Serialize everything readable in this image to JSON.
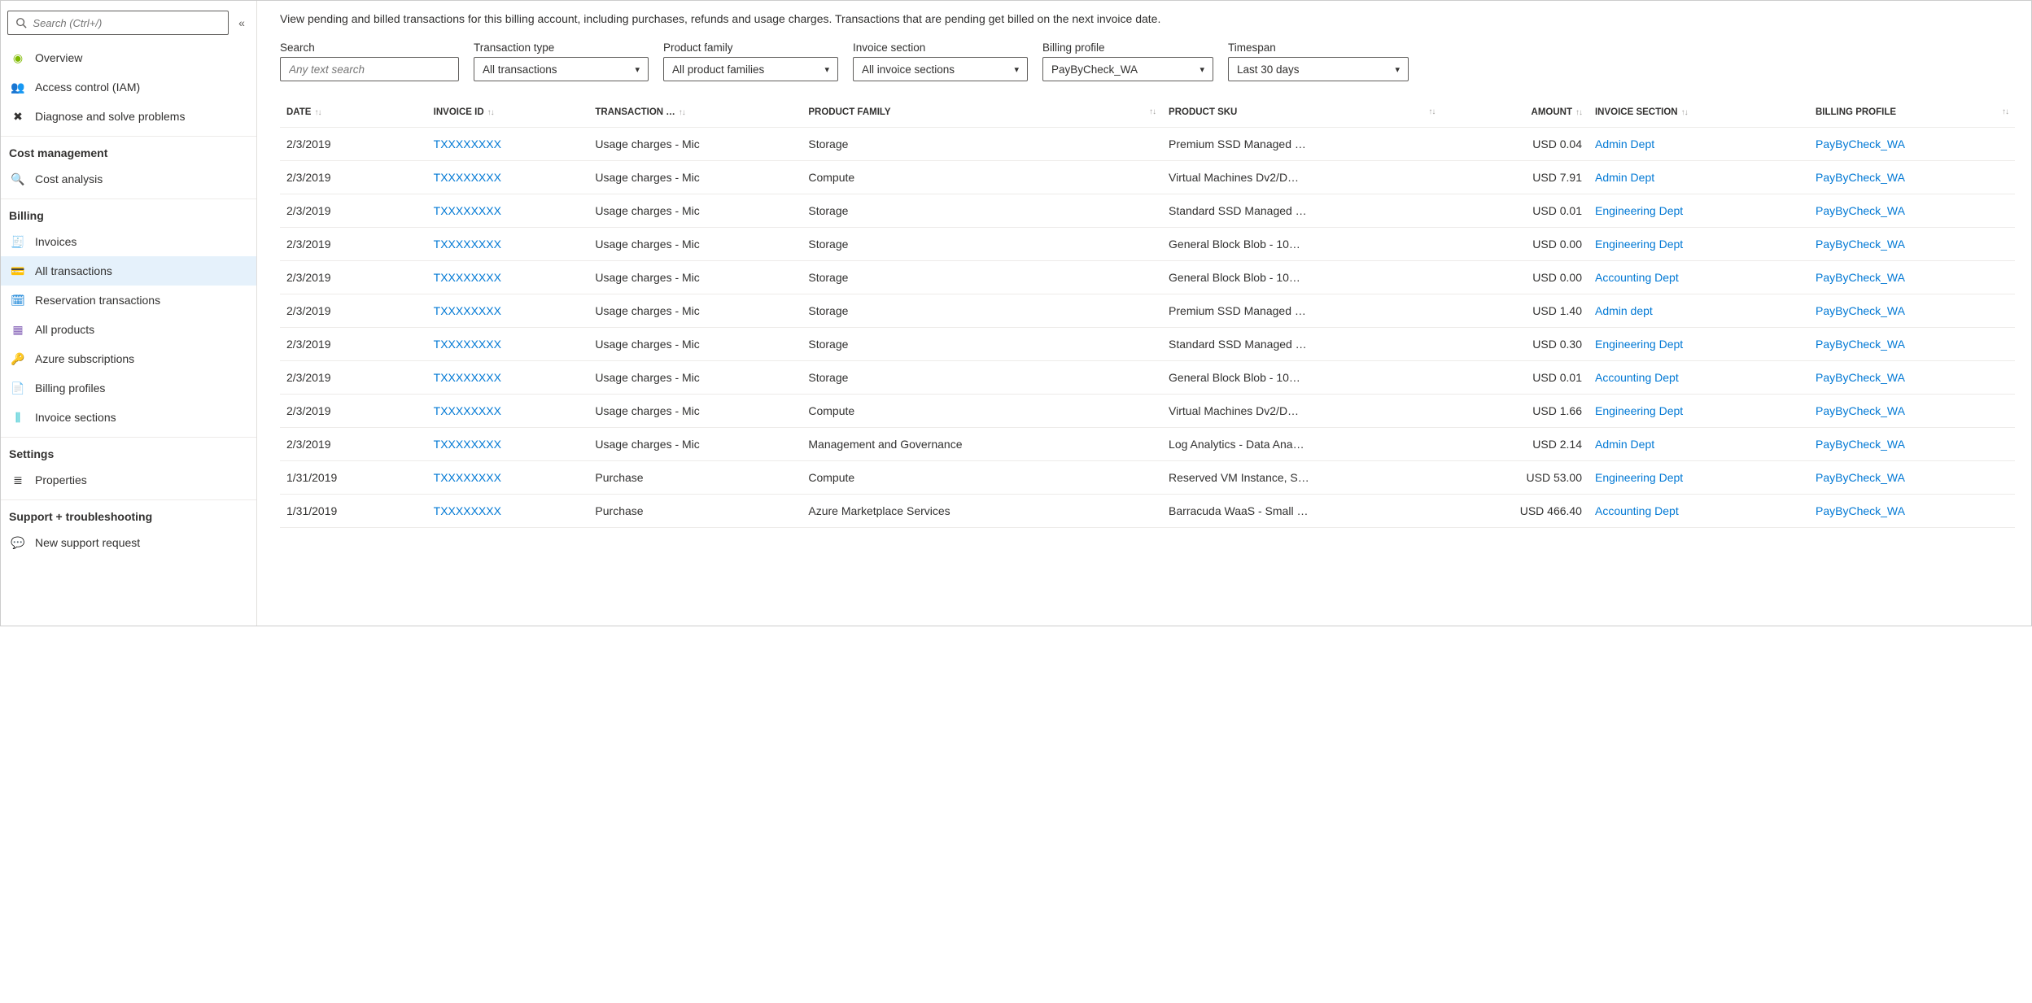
{
  "sidebar": {
    "search_placeholder": "Search (Ctrl+/)",
    "top_items": [
      {
        "label": "Overview",
        "icon": "overview-icon"
      },
      {
        "label": "Access control (IAM)",
        "icon": "iam-icon"
      },
      {
        "label": "Diagnose and solve problems",
        "icon": "diagnose-icon"
      }
    ],
    "sections": [
      {
        "title": "Cost management",
        "items": [
          {
            "label": "Cost analysis",
            "icon": "cost-analysis-icon"
          }
        ]
      },
      {
        "title": "Billing",
        "items": [
          {
            "label": "Invoices",
            "icon": "invoices-icon"
          },
          {
            "label": "All transactions",
            "icon": "transactions-icon",
            "active": true
          },
          {
            "label": "Reservation transactions",
            "icon": "reservation-icon"
          },
          {
            "label": "All products",
            "icon": "products-icon"
          },
          {
            "label": "Azure subscriptions",
            "icon": "subscriptions-icon"
          },
          {
            "label": "Billing profiles",
            "icon": "billing-profiles-icon"
          },
          {
            "label": "Invoice sections",
            "icon": "invoice-sections-icon"
          }
        ]
      },
      {
        "title": "Settings",
        "items": [
          {
            "label": "Properties",
            "icon": "properties-icon"
          }
        ]
      },
      {
        "title": "Support + troubleshooting",
        "items": [
          {
            "label": "New support request",
            "icon": "support-icon"
          }
        ]
      }
    ]
  },
  "main": {
    "intro": "View pending and billed transactions for this billing account, including purchases, refunds and usage charges. Transactions that are pending get billed on the next invoice date.",
    "filters": {
      "search": {
        "label": "Search",
        "placeholder": "Any text search"
      },
      "transaction_type": {
        "label": "Transaction type",
        "value": "All transactions"
      },
      "product_family": {
        "label": "Product family",
        "value": "All product families"
      },
      "invoice_section": {
        "label": "Invoice section",
        "value": "All invoice sections"
      },
      "billing_profile": {
        "label": "Billing profile",
        "value": "PayByCheck_WA"
      },
      "timespan": {
        "label": "Timespan",
        "value": "Last 30 days"
      }
    },
    "table": {
      "headers": {
        "date": "DATE",
        "invoice_id": "INVOICE ID",
        "transaction": "TRANSACTION …",
        "product_family": "PRODUCT FAMILY",
        "product_sku": "PRODUCT SKU",
        "amount": "AMOUNT",
        "invoice_section": "INVOICE SECTION",
        "billing_profile": "BILLING PROFILE"
      },
      "rows": [
        {
          "date": "2/3/2019",
          "invoice_id": "TXXXXXXXX",
          "transaction": "Usage charges - Mic",
          "product_family": "Storage",
          "product_sku": "Premium SSD Managed …",
          "amount": "USD 0.04",
          "invoice_section": "Admin Dept",
          "billing_profile": "PayByCheck_WA"
        },
        {
          "date": "2/3/2019",
          "invoice_id": "TXXXXXXXX",
          "transaction": "Usage charges - Mic",
          "product_family": "Compute",
          "product_sku": "Virtual Machines Dv2/D…",
          "amount": "USD 7.91",
          "invoice_section": "Admin Dept",
          "billing_profile": "PayByCheck_WA"
        },
        {
          "date": "2/3/2019",
          "invoice_id": "TXXXXXXXX",
          "transaction": "Usage charges - Mic",
          "product_family": "Storage",
          "product_sku": "Standard SSD Managed …",
          "amount": "USD 0.01",
          "invoice_section": "Engineering Dept",
          "billing_profile": "PayByCheck_WA"
        },
        {
          "date": "2/3/2019",
          "invoice_id": "TXXXXXXXX",
          "transaction": "Usage charges - Mic",
          "product_family": "Storage",
          "product_sku": "General Block Blob - 10…",
          "amount": "USD 0.00",
          "invoice_section": "Engineering Dept",
          "billing_profile": "PayByCheck_WA"
        },
        {
          "date": "2/3/2019",
          "invoice_id": "TXXXXXXXX",
          "transaction": "Usage charges - Mic",
          "product_family": "Storage",
          "product_sku": "General Block Blob - 10…",
          "amount": "USD 0.00",
          "invoice_section": "Accounting Dept",
          "billing_profile": "PayByCheck_WA"
        },
        {
          "date": "2/3/2019",
          "invoice_id": "TXXXXXXXX",
          "transaction": "Usage charges - Mic",
          "product_family": "Storage",
          "product_sku": "Premium SSD Managed …",
          "amount": "USD 1.40",
          "invoice_section": "Admin dept",
          "billing_profile": "PayByCheck_WA"
        },
        {
          "date": "2/3/2019",
          "invoice_id": "TXXXXXXXX",
          "transaction": "Usage charges - Mic",
          "product_family": "Storage",
          "product_sku": "Standard SSD Managed …",
          "amount": "USD 0.30",
          "invoice_section": "Engineering Dept",
          "billing_profile": "PayByCheck_WA"
        },
        {
          "date": "2/3/2019",
          "invoice_id": "TXXXXXXXX",
          "transaction": "Usage charges - Mic",
          "product_family": "Storage",
          "product_sku": "General Block Blob - 10…",
          "amount": "USD 0.01",
          "invoice_section": "Accounting Dept",
          "billing_profile": "PayByCheck_WA"
        },
        {
          "date": "2/3/2019",
          "invoice_id": "TXXXXXXXX",
          "transaction": "Usage charges - Mic",
          "product_family": "Compute",
          "product_sku": "Virtual Machines Dv2/D…",
          "amount": "USD 1.66",
          "invoice_section": "Engineering Dept",
          "billing_profile": "PayByCheck_WA"
        },
        {
          "date": "2/3/2019",
          "invoice_id": "TXXXXXXXX",
          "transaction": "Usage charges - Mic",
          "product_family": "Management and Governance",
          "product_sku": "Log Analytics - Data Ana…",
          "amount": "USD 2.14",
          "invoice_section": "Admin Dept",
          "billing_profile": "PayByCheck_WA"
        },
        {
          "date": "1/31/2019",
          "invoice_id": "TXXXXXXXX",
          "transaction": "Purchase",
          "product_family": "Compute",
          "product_sku": "Reserved VM Instance, S…",
          "amount": "USD 53.00",
          "invoice_section": "Engineering Dept",
          "billing_profile": "PayByCheck_WA"
        },
        {
          "date": "1/31/2019",
          "invoice_id": "TXXXXXXXX",
          "transaction": "Purchase",
          "product_family": "Azure Marketplace Services",
          "product_sku": "Barracuda WaaS - Small …",
          "amount": "USD 466.40",
          "invoice_section": "Accounting Dept",
          "billing_profile": "PayByCheck_WA"
        }
      ]
    }
  }
}
